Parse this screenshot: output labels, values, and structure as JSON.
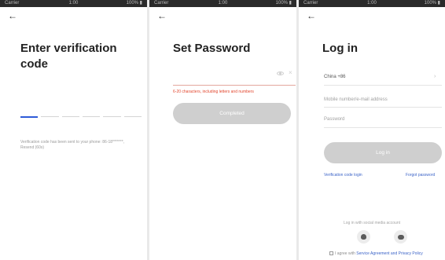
{
  "status_bar": {
    "left": "Carrier",
    "middle": "1:00",
    "right": "100% ▮"
  },
  "screen_verify": {
    "back": "←",
    "title_line1": "Enter verification",
    "title_line2": "code",
    "hint": "Verification code has been sent to your phone: 86-18*******, Resend (60s)"
  },
  "screen_password": {
    "back": "←",
    "title": "Set Password",
    "clear_glyph": "×",
    "error": "6-20 characters, including letters and numbers",
    "button": "Completed"
  },
  "screen_login": {
    "back": "←",
    "title": "Log in",
    "region": "China +86",
    "chevron": "›",
    "account_placeholder": "Mobile number/e-mail address",
    "password_placeholder": "Password",
    "button": "Log in",
    "link_code_login": "Verification code login",
    "link_forgot": "Forgot password",
    "social_label": "Log in with social media account",
    "agree_prefix": "I agree with",
    "agree_terms": "Service Agreement and Privacy Policy"
  }
}
